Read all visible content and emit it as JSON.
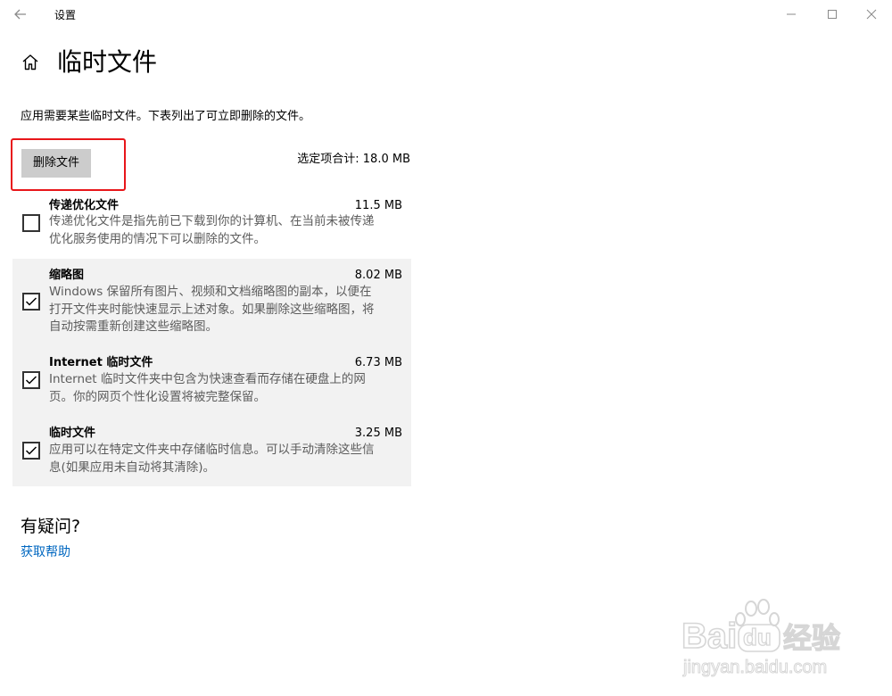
{
  "window": {
    "title": "设置",
    "back_icon": "arrow-left-icon",
    "minimize_glyph": "—",
    "maximize_glyph": "☐",
    "close_glyph": "✕"
  },
  "header": {
    "home_icon": "home-icon",
    "title": "临时文件"
  },
  "intro_text": "应用需要某些临时文件。下表列出了可立即删除的文件。",
  "actions": {
    "delete_button_label": "删除文件",
    "total_text": "选定项合计: 18.0 MB",
    "highlight_color": "#e8161a"
  },
  "items": [
    {
      "name": "传递优化文件",
      "size": "11.5 MB",
      "checked": false,
      "desc_lines": [
        "传递优化文件是指先前已下载到你的计算机、在当前未被传递",
        "优化服务使用的情况下可以删除的文件。"
      ]
    },
    {
      "name": "缩略图",
      "size": "8.02 MB",
      "checked": true,
      "desc_lines": [
        "Windows 保留所有图片、视频和文档缩略图的副本，以便在",
        "打开文件夹时能快速显示上述对象。如果删除这些缩略图，将",
        "自动按需重新创建这些缩略图。"
      ]
    },
    {
      "name": "Internet 临时文件",
      "size": "6.73 MB",
      "checked": true,
      "desc_lines": [
        "Internet 临时文件夹中包含为快速查看而存储在硬盘上的网",
        "页。你的网页个性化设置将被完整保留。"
      ]
    },
    {
      "name": "临时文件",
      "size": "3.25 MB",
      "checked": true,
      "desc_lines": [
        "应用可以在特定文件夹中存储临时信息。可以手动清除这些信",
        "息(如果应用未自动将其清除)。"
      ]
    }
  ],
  "help": {
    "title": "有疑问?",
    "link": "获取帮助"
  },
  "watermark": {
    "brand": "Bai",
    "brand2": "du",
    "suffix": "经验",
    "url": "jingyan.baidu.com"
  },
  "colors": {
    "accent_link": "#0067c0",
    "selected_bg": "#f2f2f2",
    "button_bg": "#cccccc"
  }
}
